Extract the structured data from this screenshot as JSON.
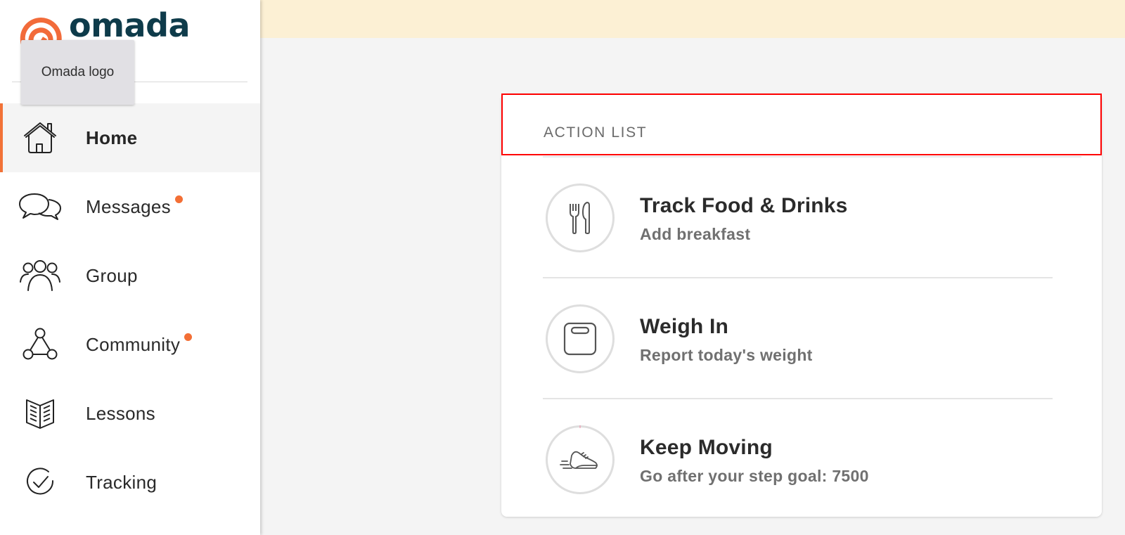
{
  "brand": {
    "name": "omada",
    "logo_icon": "omada-arcs-logo",
    "logo_color": "#f26b3a",
    "wordmark_color": "#0e3b4a",
    "tooltip": "Omada logo"
  },
  "sidebar": {
    "active_color": "#f27237",
    "items": [
      {
        "label": "Home",
        "icon": "home-icon",
        "active": true,
        "badge": false
      },
      {
        "label": "Messages",
        "icon": "chat-bubbles-icon",
        "active": false,
        "badge": true
      },
      {
        "label": "Group",
        "icon": "group-people-icon",
        "active": false,
        "badge": false
      },
      {
        "label": "Community",
        "icon": "community-network-icon",
        "active": false,
        "badge": true
      },
      {
        "label": "Lessons",
        "icon": "open-book-icon",
        "active": false,
        "badge": false
      },
      {
        "label": "Tracking",
        "icon": "check-circle-icon",
        "active": false,
        "badge": false
      }
    ]
  },
  "banner": {
    "color": "#fcf0d4"
  },
  "action_list": {
    "title": "ACTION LIST",
    "items": [
      {
        "title": "Track Food & Drinks",
        "subtitle": "Add breakfast",
        "icon": "fork-knife-icon",
        "progress": null
      },
      {
        "title": "Weigh In",
        "subtitle": "Report today's weight",
        "icon": "scale-icon",
        "progress": null
      },
      {
        "title": "Keep Moving",
        "subtitle": "Go after your step goal: 7500",
        "icon": "running-shoe-icon",
        "progress": 0.0
      }
    ]
  }
}
